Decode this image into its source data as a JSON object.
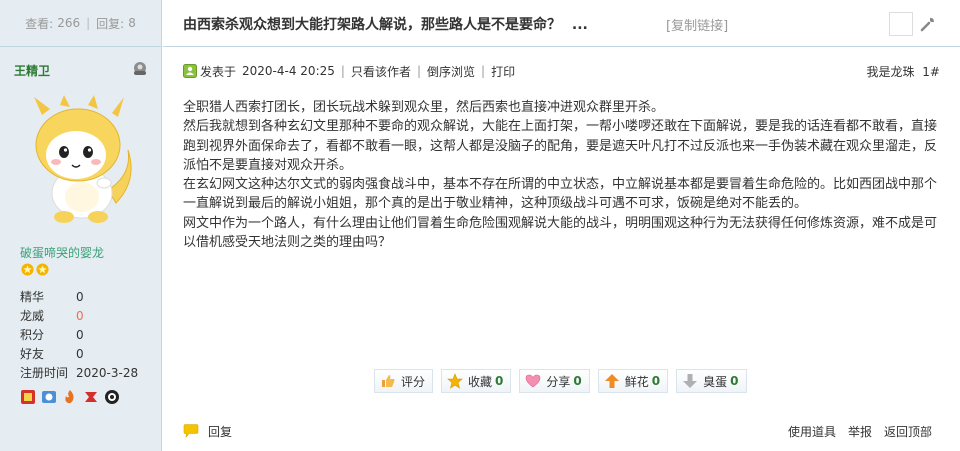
{
  "stats": {
    "views_label": "查看:",
    "views": "266",
    "replies_label": "回复:",
    "replies": "8"
  },
  "author": {
    "name": "王精卫",
    "usertitle": "破蛋啼哭的婴龙"
  },
  "profile": [
    {
      "key": "精华",
      "value": "0"
    },
    {
      "key": "龙威",
      "value": "0"
    },
    {
      "key": "积分",
      "value": "0"
    },
    {
      "key": "好友",
      "value": "0"
    },
    {
      "key": "注册时间",
      "value": "2020-3-28"
    }
  ],
  "thread": {
    "title": "由西索杀观众想到大能打架路人解说，那些路人是不是要命？",
    "ellipsis": "...",
    "copy_link": "[复制链接]"
  },
  "meta": {
    "posted_label": "发表于",
    "date": "2020-4-4 20:25",
    "only_author": "只看该作者",
    "reverse": "倒序浏览",
    "print": "打印",
    "floor_text": "我是龙珠",
    "floor_num": "1#"
  },
  "content": [
    "全职猎人西索打团长，团长玩战术躲到观众里，然后西索也直接冲进观众群里开杀。",
    "然后我就想到各种玄幻文里那种不要命的观众解说，大能在上面打架，一帮小喽啰还敢在下面解说，要是我的话连看都不敢看，直接跑到视界外面保命去了，看都不敢看一眼，这帮人都是没脑子的配角，要是遮天叶凡打不过反派也来一手伪装术藏在观众里溜走，反派怕不是要直接对观众开杀。",
    "在玄幻网文这种达尔文式的弱肉强食战斗中，基本不存在所谓的中立状态，中立解说基本都是要冒着生命危险的。比如西团战中那个一直解说到最后的解说小姐姐，那个真的是出于敬业精神，这种顶级战斗可遇不可求，饭碗是绝对不能丢的。",
    "网文中作为一个路人，有什么理由让他们冒着生命危险围观解说大能的战斗，明明围观这种行为无法获得任何修炼资源，难不成是可以借机感受天地法则之类的理由吗？"
  ],
  "actions": {
    "rate": "评分",
    "favorite": "收藏",
    "favorite_count": "0",
    "share": "分享",
    "share_count": "0",
    "flower": "鲜花",
    "flower_count": "0",
    "egg": "臭蛋",
    "egg_count": "0"
  },
  "footer": {
    "reply": "回复",
    "use_tool": "使用道具",
    "report": "举报",
    "top": "返回顶部"
  },
  "colors": {
    "sidebar_bg": "#e5edf2",
    "border": "#c2d5e3",
    "author": "#2d7a34",
    "usertitle": "#3aa077",
    "red_value": "#f26c4f"
  },
  "icons": [
    "online-status-icon",
    "dragon-avatar",
    "star-icon",
    "medal-icons",
    "tool-icon",
    "thumb-icon",
    "heart-icon",
    "arrow-up-icon",
    "arrow-down-icon",
    "reply-bubble-icon"
  ]
}
